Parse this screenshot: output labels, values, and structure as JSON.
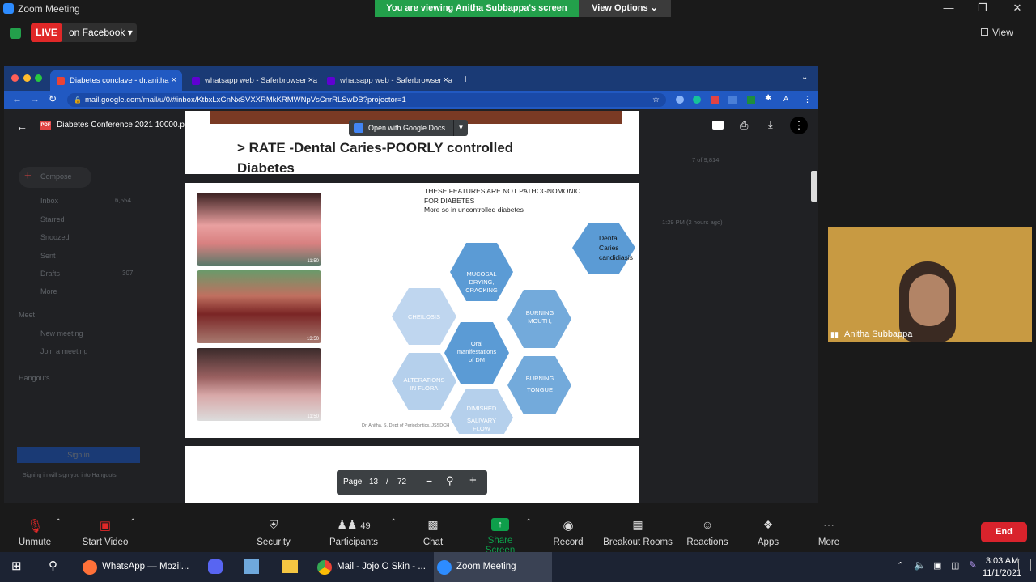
{
  "window": {
    "title": "Zoom Meeting",
    "banner": "You are viewing Anitha Subbappa's screen",
    "view_options": "View Options ⌄"
  },
  "topbar": {
    "live": "LIVE",
    "live_target": "on Facebook ▾",
    "view": "View"
  },
  "browser": {
    "tabs": [
      {
        "label": "Diabetes conclave - dr.anitha.s",
        "close": "×"
      },
      {
        "label": "whatsapp web - Saferbrowser Ya",
        "close": "×"
      },
      {
        "label": "whatsapp web - Saferbrowser Ya",
        "close": "×"
      }
    ],
    "new_tab": "+",
    "url": "mail.google.com/mail/u/0/#inbox/KtbxLxGnNxSVXXRMkKRMWNpVsCnrRLSwDB?projector=1"
  },
  "pdf": {
    "filename": "Diabetes Conference 2021 10000.pdf",
    "open_with": "Open with Google Docs",
    "slide_title": "> RATE -Dental Caries-POORLY controlled Diabetes",
    "features_note_1": "THESE FEATURES ARE NOT PATHOGNOMONIC",
    "features_note_2": "FOR DIABETES",
    "features_note_3": "More so in uncontrolled diabetes",
    "photo_timestamps": [
      "11:50",
      "13:50",
      "11:50"
    ],
    "hex_center": [
      "Oral",
      "manifestations",
      "of DM"
    ],
    "hex_top": [
      "MUCOSAL",
      "DRYING,",
      "CRACKING"
    ],
    "hex_top_right": [
      "BURNING",
      "MOUTH,"
    ],
    "hex_bottom_right": [
      "BURNING",
      "TONGUE"
    ],
    "hex_bottom": [
      "DIMISHED",
      "SALIVARY",
      "FLOW"
    ],
    "hex_bottom_left": [
      "ALTERATIONS",
      "IN FLORA"
    ],
    "hex_top_left": [
      "CHEILOSIS"
    ],
    "hex_side": [
      "Dental",
      "Caries",
      "candidiasis"
    ],
    "credit": "Dr. Anitha. S, Dept of Periodontics, JSSDCH",
    "page_label": "Page",
    "page_current": "13",
    "page_sep": "/",
    "page_total": "72"
  },
  "gmail": {
    "compose": "Compose",
    "items": [
      "Inbox",
      "Starred",
      "Snoozed",
      "Sent",
      "Drafts",
      "More"
    ],
    "inbox_count": "6,554",
    "drafts_count": "307",
    "meet": "Meet",
    "meet_items": [
      "New meeting",
      "Join a meeting"
    ],
    "hangouts": "Hangouts",
    "sign_in": "Sign in",
    "sign_in_note": "Signing in will sign you into Hangouts",
    "counter": "7 of 9,814",
    "time": "1:29 PM (2 hours ago)"
  },
  "webcam": {
    "name": "Anitha Subbappa"
  },
  "toolbar": {
    "unmute": "Unmute",
    "start_video": "Start Video",
    "security": "Security",
    "participants": "Participants",
    "participants_count": "49",
    "chat": "Chat",
    "share_screen": "Share Screen",
    "record": "Record",
    "breakout": "Breakout Rooms",
    "reactions": "Reactions",
    "apps": "Apps",
    "more": "More",
    "end": "End"
  },
  "taskbar": {
    "apps": [
      "WhatsApp — Mozil...",
      "Mail - Jojo O Skin - ...",
      "Zoom Meeting"
    ],
    "time": "3:03 AM",
    "date": "11/1/2021"
  },
  "colors": {
    "live": "#e02828",
    "banner": "#23a04b",
    "share": "#0e9f4b",
    "end": "#d9232c",
    "hex": "#5b9bd5",
    "chrome_tab": "#1a3a75"
  }
}
